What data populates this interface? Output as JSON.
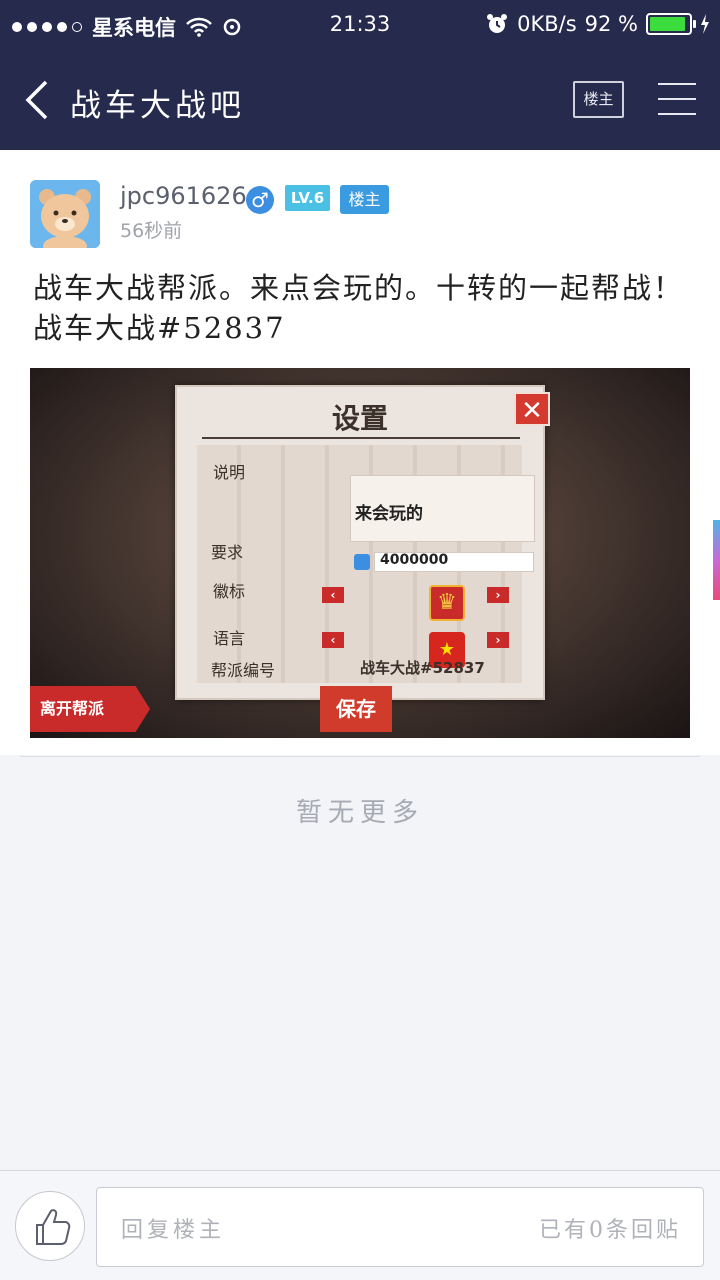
{
  "status_bar": {
    "carrier": "星系电信",
    "time": "21:33",
    "net_speed": "0KB/s",
    "battery_percent": "92 %",
    "battery_level": 0.92
  },
  "nav": {
    "title": "战车大战吧",
    "owner_button": "楼主"
  },
  "post": {
    "username": "jpc961626",
    "gender": "♂",
    "level": "LV.6",
    "host_badge": "楼主",
    "time_ago": "56秒前",
    "content": "战车大战帮派。来点会玩的。十转的一起帮战！ 战车大战#52837",
    "image": {
      "panel_title": "设置",
      "label_desc": "说明",
      "desc_value": "来会玩的",
      "label_req": "要求",
      "req_value": "4000000",
      "label_emblem": "徽标",
      "label_lang": "语言",
      "label_id": "帮派编号",
      "id_value": "战车大战#52837",
      "save": "保存",
      "leave": "离开帮派"
    }
  },
  "feed": {
    "no_more": "暂无更多"
  },
  "bottom": {
    "reply_placeholder": "回复楼主",
    "reply_count": "已有0条回贴"
  }
}
